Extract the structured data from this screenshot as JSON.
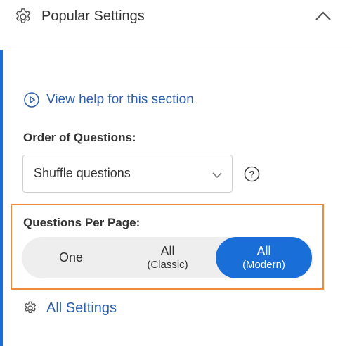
{
  "header": {
    "title": "Popular Settings",
    "icon": "gear-icon",
    "toggle_icon": "chevron-up-icon"
  },
  "help": {
    "icon": "play-circle-icon",
    "label": "View help for this section"
  },
  "order": {
    "label": "Order of Questions:",
    "selected": "Shuffle questions",
    "dropdown_icon": "chevron-down-icon",
    "help_icon": "question-circle-icon"
  },
  "questions_per_page": {
    "label": "Questions Per Page:",
    "options": [
      {
        "main": "One",
        "sub": ""
      },
      {
        "main": "All",
        "sub": "(Classic)"
      },
      {
        "main": "All",
        "sub": "(Modern)"
      }
    ],
    "selected_index": 2
  },
  "all_settings": {
    "icon": "gear-icon",
    "label": "All Settings"
  },
  "colors": {
    "accent": "#1a6ed8",
    "link": "#2e5fa8",
    "highlight_border": "#ef8b3b",
    "segment_bg": "#eeeeee"
  }
}
